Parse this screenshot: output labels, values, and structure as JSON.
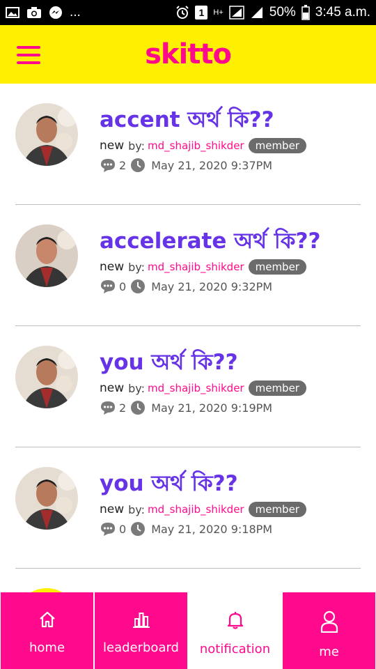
{
  "status_bar": {
    "dots": "...",
    "sim": "1",
    "network": "H+",
    "battery": "50%",
    "time": "3:45 a.m."
  },
  "app": {
    "logo": "skitto"
  },
  "posts": [
    {
      "title_en": "accent",
      "title_bn": "অর্থ কি??",
      "status": "new",
      "by_label": "by:",
      "author": "md_shajib_shikder",
      "badge": "member",
      "comments": "2",
      "datetime": "May 21, 2020 9:37PM"
    },
    {
      "title_en": "accelerate",
      "title_bn": "অর্থ কি??",
      "status": "new",
      "by_label": "by:",
      "author": "md_shajib_shikder",
      "badge": "member",
      "comments": "0",
      "datetime": "May 21, 2020 9:32PM"
    },
    {
      "title_en": "you",
      "title_bn": "অর্থ কি??",
      "status": "new",
      "by_label": "by:",
      "author": "md_shajib_shikder",
      "badge": "member",
      "comments": "2",
      "datetime": "May 21, 2020 9:19PM"
    },
    {
      "title_en": "you",
      "title_bn": "অর্থ কি??",
      "status": "new",
      "by_label": "by:",
      "author": "md_shajib_shikder",
      "badge": "member",
      "comments": "0",
      "datetime": "May 21, 2020 9:18PM"
    }
  ],
  "nav": {
    "home": "home",
    "leaderboard": "leaderboard",
    "notification": "notification",
    "me": "me"
  },
  "colors": {
    "brand_pink": "#ff0a8c",
    "brand_yellow": "#ffef00",
    "title_purple": "#6633e6",
    "badge_gray": "#6b6b6b"
  }
}
